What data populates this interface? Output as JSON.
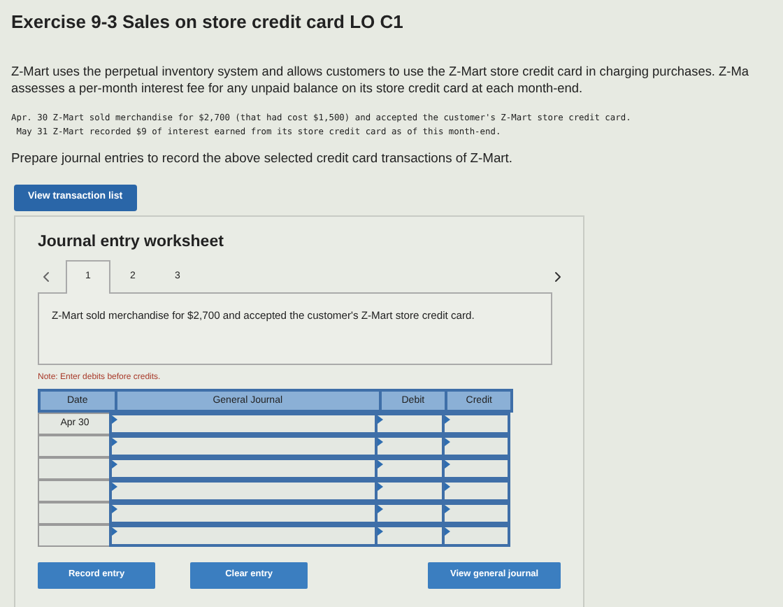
{
  "title": "Exercise 9-3 Sales on store credit card LO C1",
  "intro_lines": [
    "Z-Mart uses the perpetual inventory system and allows customers to use the Z-Mart store credit card in charging purchases. Z-Ma",
    "assesses a per-month interest fee for any unpaid balance on its store credit card at each month-end."
  ],
  "transactions": [
    "Apr. 30 Z-Mart sold merchandise for $2,700 (that had cost $1,500) and accepted the customer's Z-Mart store credit card.",
    " May 31 Z-Mart recorded $9 of interest earned from its store credit card as of this month-end."
  ],
  "instruction": "Prepare journal entries to record the above selected credit card transactions of Z-Mart.",
  "view_list_button": "View transaction list",
  "worksheet": {
    "heading": "Journal entry worksheet",
    "tabs": [
      {
        "label": "1",
        "selected": true
      },
      {
        "label": "2",
        "selected": false
      },
      {
        "label": "3",
        "selected": false
      }
    ],
    "description": "Z-Mart sold merchandise for $2,700 and accepted the customer's Z-Mart store credit card.",
    "note": "Note: Enter debits before credits.",
    "table": {
      "columns": [
        "Date",
        "General Journal",
        "Debit",
        "Credit"
      ],
      "rows": [
        {
          "date": "Apr 30"
        },
        {},
        {},
        {},
        {},
        {}
      ]
    },
    "buttons": [
      "Record entry",
      "Clear entry",
      "View general journal"
    ]
  }
}
